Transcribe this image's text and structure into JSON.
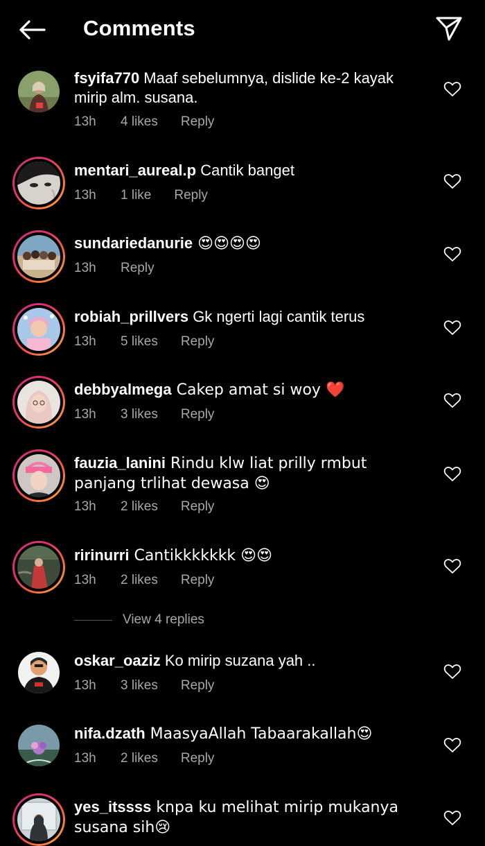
{
  "header": {
    "title": "Comments",
    "back_icon": "arrow-left-icon",
    "share_icon": "paper-plane-icon"
  },
  "comments": [
    {
      "username": "fsyifa770",
      "text": " Maaf sebelumnya, dislide ke-2 kayak mirip alm. susana.",
      "time": "13h",
      "likes": "4 likes",
      "reply": "Reply"
    },
    {
      "username": "mentari_aureal.p",
      "text": " Cantik banget",
      "time": "13h",
      "likes": "1 like",
      "reply": "Reply"
    },
    {
      "username": "sundariedanurie",
      "text": " 😍😍😍😍",
      "time": "13h",
      "likes": "",
      "reply": "Reply"
    },
    {
      "username": "robiah_prillvers",
      "text": " Gk ngerti lagi cantik terus",
      "time": "13h",
      "likes": "5 likes",
      "reply": "Reply"
    },
    {
      "username": "debbyalmega",
      "text": " Cakep amat si woy ❤️",
      "time": "13h",
      "likes": "3 likes",
      "reply": "Reply"
    },
    {
      "username": "fauzia_lanini",
      "text": " Rindu klw liat prilly rmbut panjang trlihat dewasa 😍",
      "time": "13h",
      "likes": "2 likes",
      "reply": "Reply"
    },
    {
      "username": "ririnurri",
      "text": " Cantikkkkkkk 😍😍",
      "time": "13h",
      "likes": "2 likes",
      "reply": "Reply"
    },
    {
      "username": "oskar_oaziz",
      "text": " Ko mirip suzana yah ..",
      "time": "13h",
      "likes": "3 likes",
      "reply": "Reply"
    },
    {
      "username": "nifa.dzath",
      "text": " MaasyaAllah Tabaarakallah😍",
      "time": "13h",
      "likes": "2 likes",
      "reply": "Reply"
    },
    {
      "username": "yes_itssss",
      "text": " knpa ku melihat mirip mukanya susana sih😢",
      "time": "",
      "likes": "",
      "reply": ""
    }
  ],
  "view_replies": "View 4 replies",
  "heart_icon": "heart-outline-icon",
  "colors": {
    "background": "#000000",
    "text": "#ffffff",
    "secondary": "#a8a8a8",
    "story_ring": "#e1306c"
  }
}
